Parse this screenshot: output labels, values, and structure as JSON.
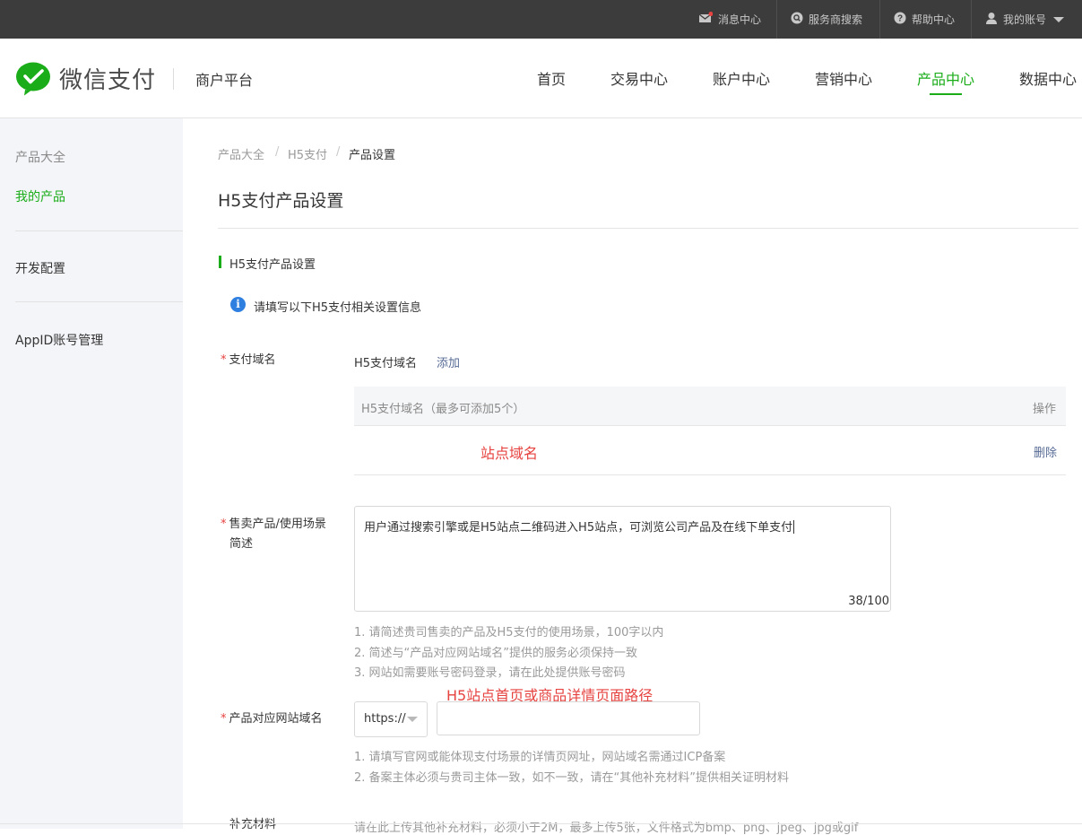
{
  "topbar": {
    "items": [
      {
        "label": "消息中心",
        "icon": "mail-icon"
      },
      {
        "label": "服务商搜索",
        "icon": "search-icon"
      },
      {
        "label": "帮助中心",
        "icon": "help-icon"
      },
      {
        "label": "我的账号",
        "icon": "user-icon"
      }
    ]
  },
  "header": {
    "logo_text": "微信支付",
    "platform": "商户平台",
    "nav": [
      "首页",
      "交易中心",
      "账户中心",
      "营销中心",
      "产品中心",
      "数据中心"
    ],
    "active_nav": "产品中心"
  },
  "sidebar": {
    "items": [
      "产品大全",
      "我的产品",
      "开发配置",
      "AppID账号管理"
    ],
    "active": "我的产品"
  },
  "breadcrumb": [
    "产品大全",
    "H5支付",
    "产品设置"
  ],
  "page_title": "H5支付产品设置",
  "section_title": "H5支付产品设置",
  "info_text": "请填写以下H5支付相关设置信息",
  "form": {
    "domain": {
      "label": "支付域名",
      "field_name": "H5支付域名",
      "add_link": "添加",
      "table_header": "H5支付域名（最多可添加5个）",
      "table_action_header": "操作",
      "row_note": "站点域名",
      "delete_link": "删除"
    },
    "scene": {
      "label_line1": "售卖产品/使用场景",
      "label_line2": "简述",
      "value": "用户通过搜索引擎或是H5站点二维码进入H5站点，可浏览公司产品及在线下单支付",
      "counter": "38/100",
      "hints": [
        "1. 请简述贵司售卖的产品及H5支付的使用场景，100字以内",
        "2. 简述与“产品对应网站域名”提供的服务必须保持一致",
        "3. 网站如需要账号密码登录，请在此处提供账号密码"
      ]
    },
    "site": {
      "note": "H5站点首页或商品详情页面路径",
      "label": "产品对应网站域名",
      "protocol": "https://",
      "value": "",
      "hints": [
        "1. 请填写官网或能体现支付场景的详情页网址，网站域名需通过ICP备案",
        "2. 备案主体必须与贵司主体一致，如不一致，请在“其他补充材料”提供相关证明材料"
      ]
    },
    "extra": {
      "label": "补充材料",
      "hint": "请在此上传其他补充材料，必须小于2M，最多上传5张，文件格式为bmp、png、jpeg、jpg或gif"
    }
  },
  "colors": {
    "brand_green": "#1aad19",
    "link_blue": "#576b95",
    "required_red": "#e64340",
    "topbar_bg": "#3c3c3c",
    "info_blue": "#2f7fe1"
  }
}
